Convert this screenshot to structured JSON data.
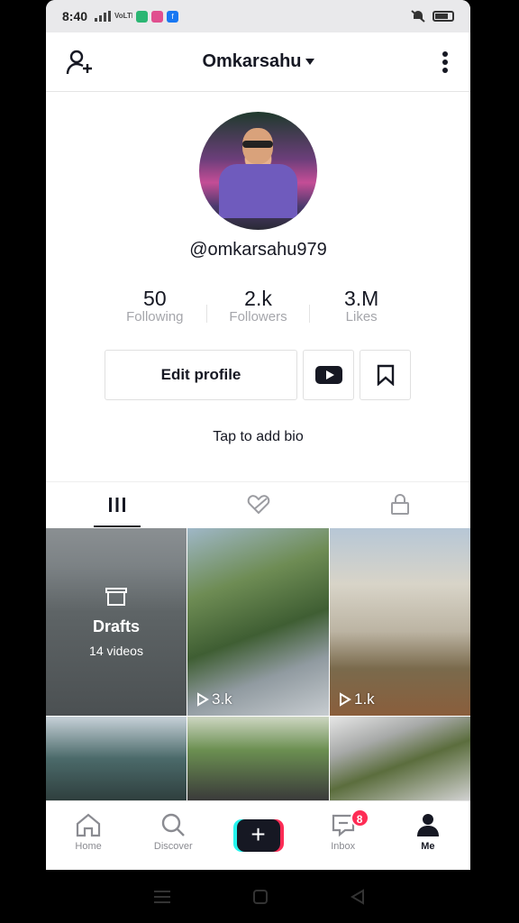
{
  "status_bar": {
    "time": "8:40",
    "network_label": "VoLTE"
  },
  "header": {
    "title": "Omkarsahu"
  },
  "profile": {
    "handle": "@omkarsahu979",
    "bio_prompt": "Tap to add bio"
  },
  "stats": [
    {
      "value": "50",
      "label": "Following"
    },
    {
      "value": "2.k",
      "label": "Followers"
    },
    {
      "value": "3.M",
      "label": "Likes"
    }
  ],
  "buttons": {
    "edit_profile": "Edit profile"
  },
  "drafts": {
    "title": "Drafts",
    "count": "14 videos"
  },
  "videos": [
    {
      "plays": "3.k"
    },
    {
      "plays": "1.k"
    }
  ],
  "bottom_nav": {
    "home": "Home",
    "discover": "Discover",
    "create": "+",
    "inbox": "Inbox",
    "inbox_badge": "8",
    "me": "Me"
  },
  "colors": {
    "accent_red": "#fe2c55",
    "accent_cyan": "#25f4ee",
    "text_dark": "#161823",
    "text_grey": "#a5a6ab"
  }
}
